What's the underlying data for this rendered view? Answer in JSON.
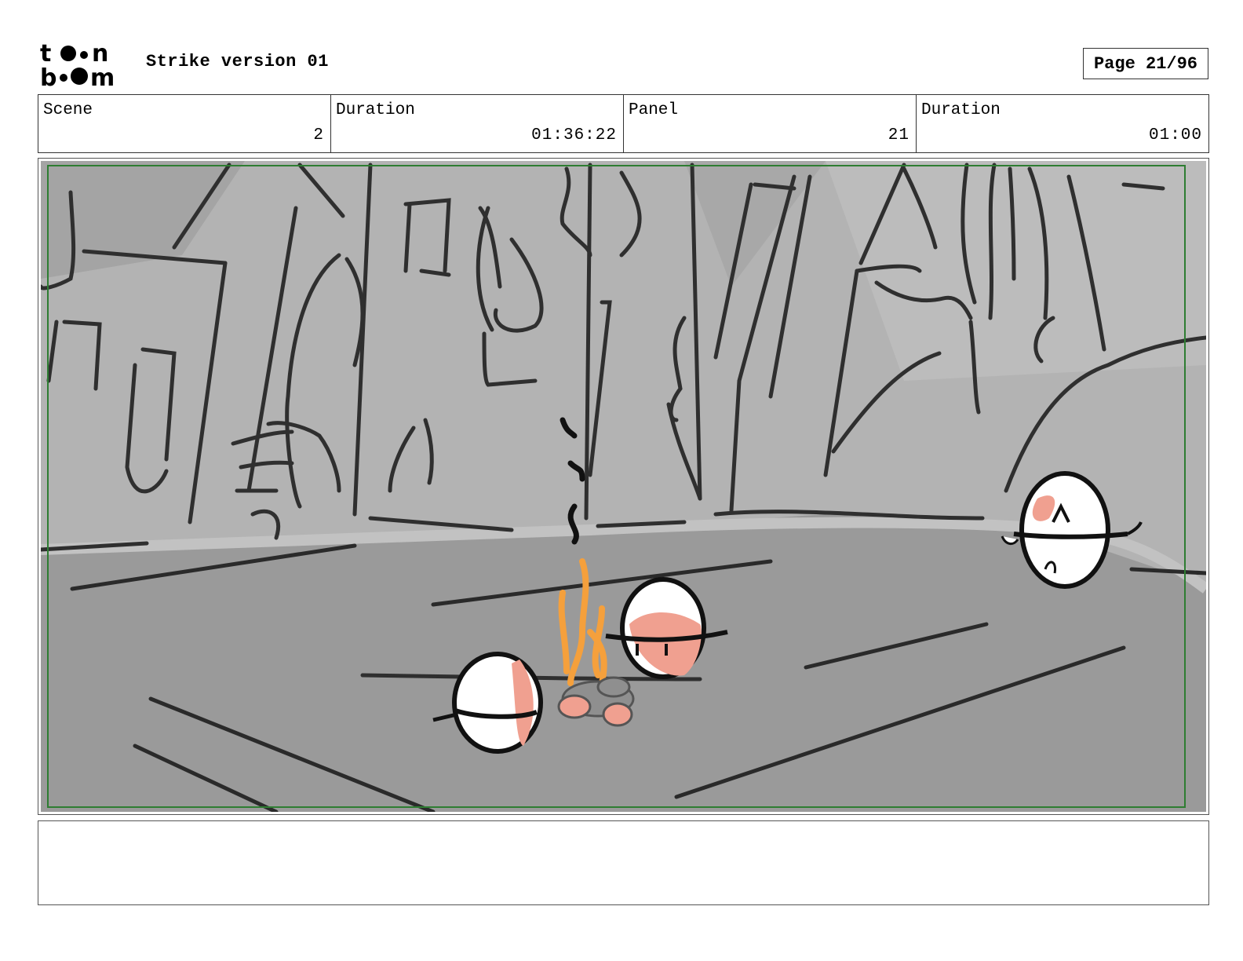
{
  "header": {
    "logo_text": "toon boom",
    "title": "Strike version 01",
    "page": "Page 21/96"
  },
  "info": {
    "scene_label": "Scene",
    "scene_value": "2",
    "scene_duration_label": "Duration",
    "scene_duration_value": "01:36:22",
    "panel_label": "Panel",
    "panel_value": "21",
    "panel_duration_label": "Duration",
    "panel_duration_value": "01:00"
  },
  "colors": {
    "safe_frame": "#2e7d32",
    "wall": "#b0b0b0",
    "floor": "#9a9a9a",
    "fire": "#f5a03c",
    "skin": "#f0a090"
  },
  "panel": {
    "illustration": "storyboard-sketch"
  },
  "notes": {
    "text": ""
  }
}
